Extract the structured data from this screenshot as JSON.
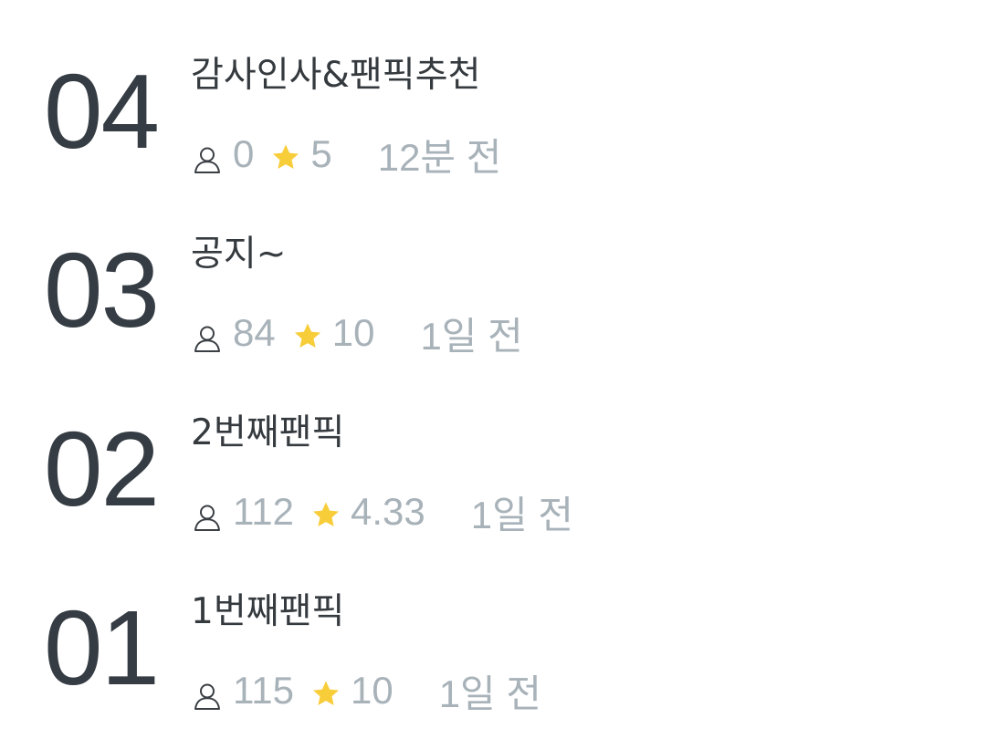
{
  "colors": {
    "number": "#353c43",
    "title": "#353a3f",
    "meta": "#a8b2b9",
    "star": "#f8cd3a"
  },
  "icons": {
    "viewer": "user-icon",
    "rating": "star-icon"
  },
  "episodes": [
    {
      "number": "04",
      "title": "감사인사&팬픽추천",
      "views": "0",
      "rating": "5",
      "time": "12분 전"
    },
    {
      "number": "03",
      "title": "공지~",
      "views": "84",
      "rating": "10",
      "time": "1일 전"
    },
    {
      "number": "02",
      "title": "2번째팬픽",
      "views": "112",
      "rating": "4.33",
      "time": "1일 전"
    },
    {
      "number": "01",
      "title": "1번째팬픽",
      "views": "115",
      "rating": "10",
      "time": "1일 전"
    }
  ]
}
